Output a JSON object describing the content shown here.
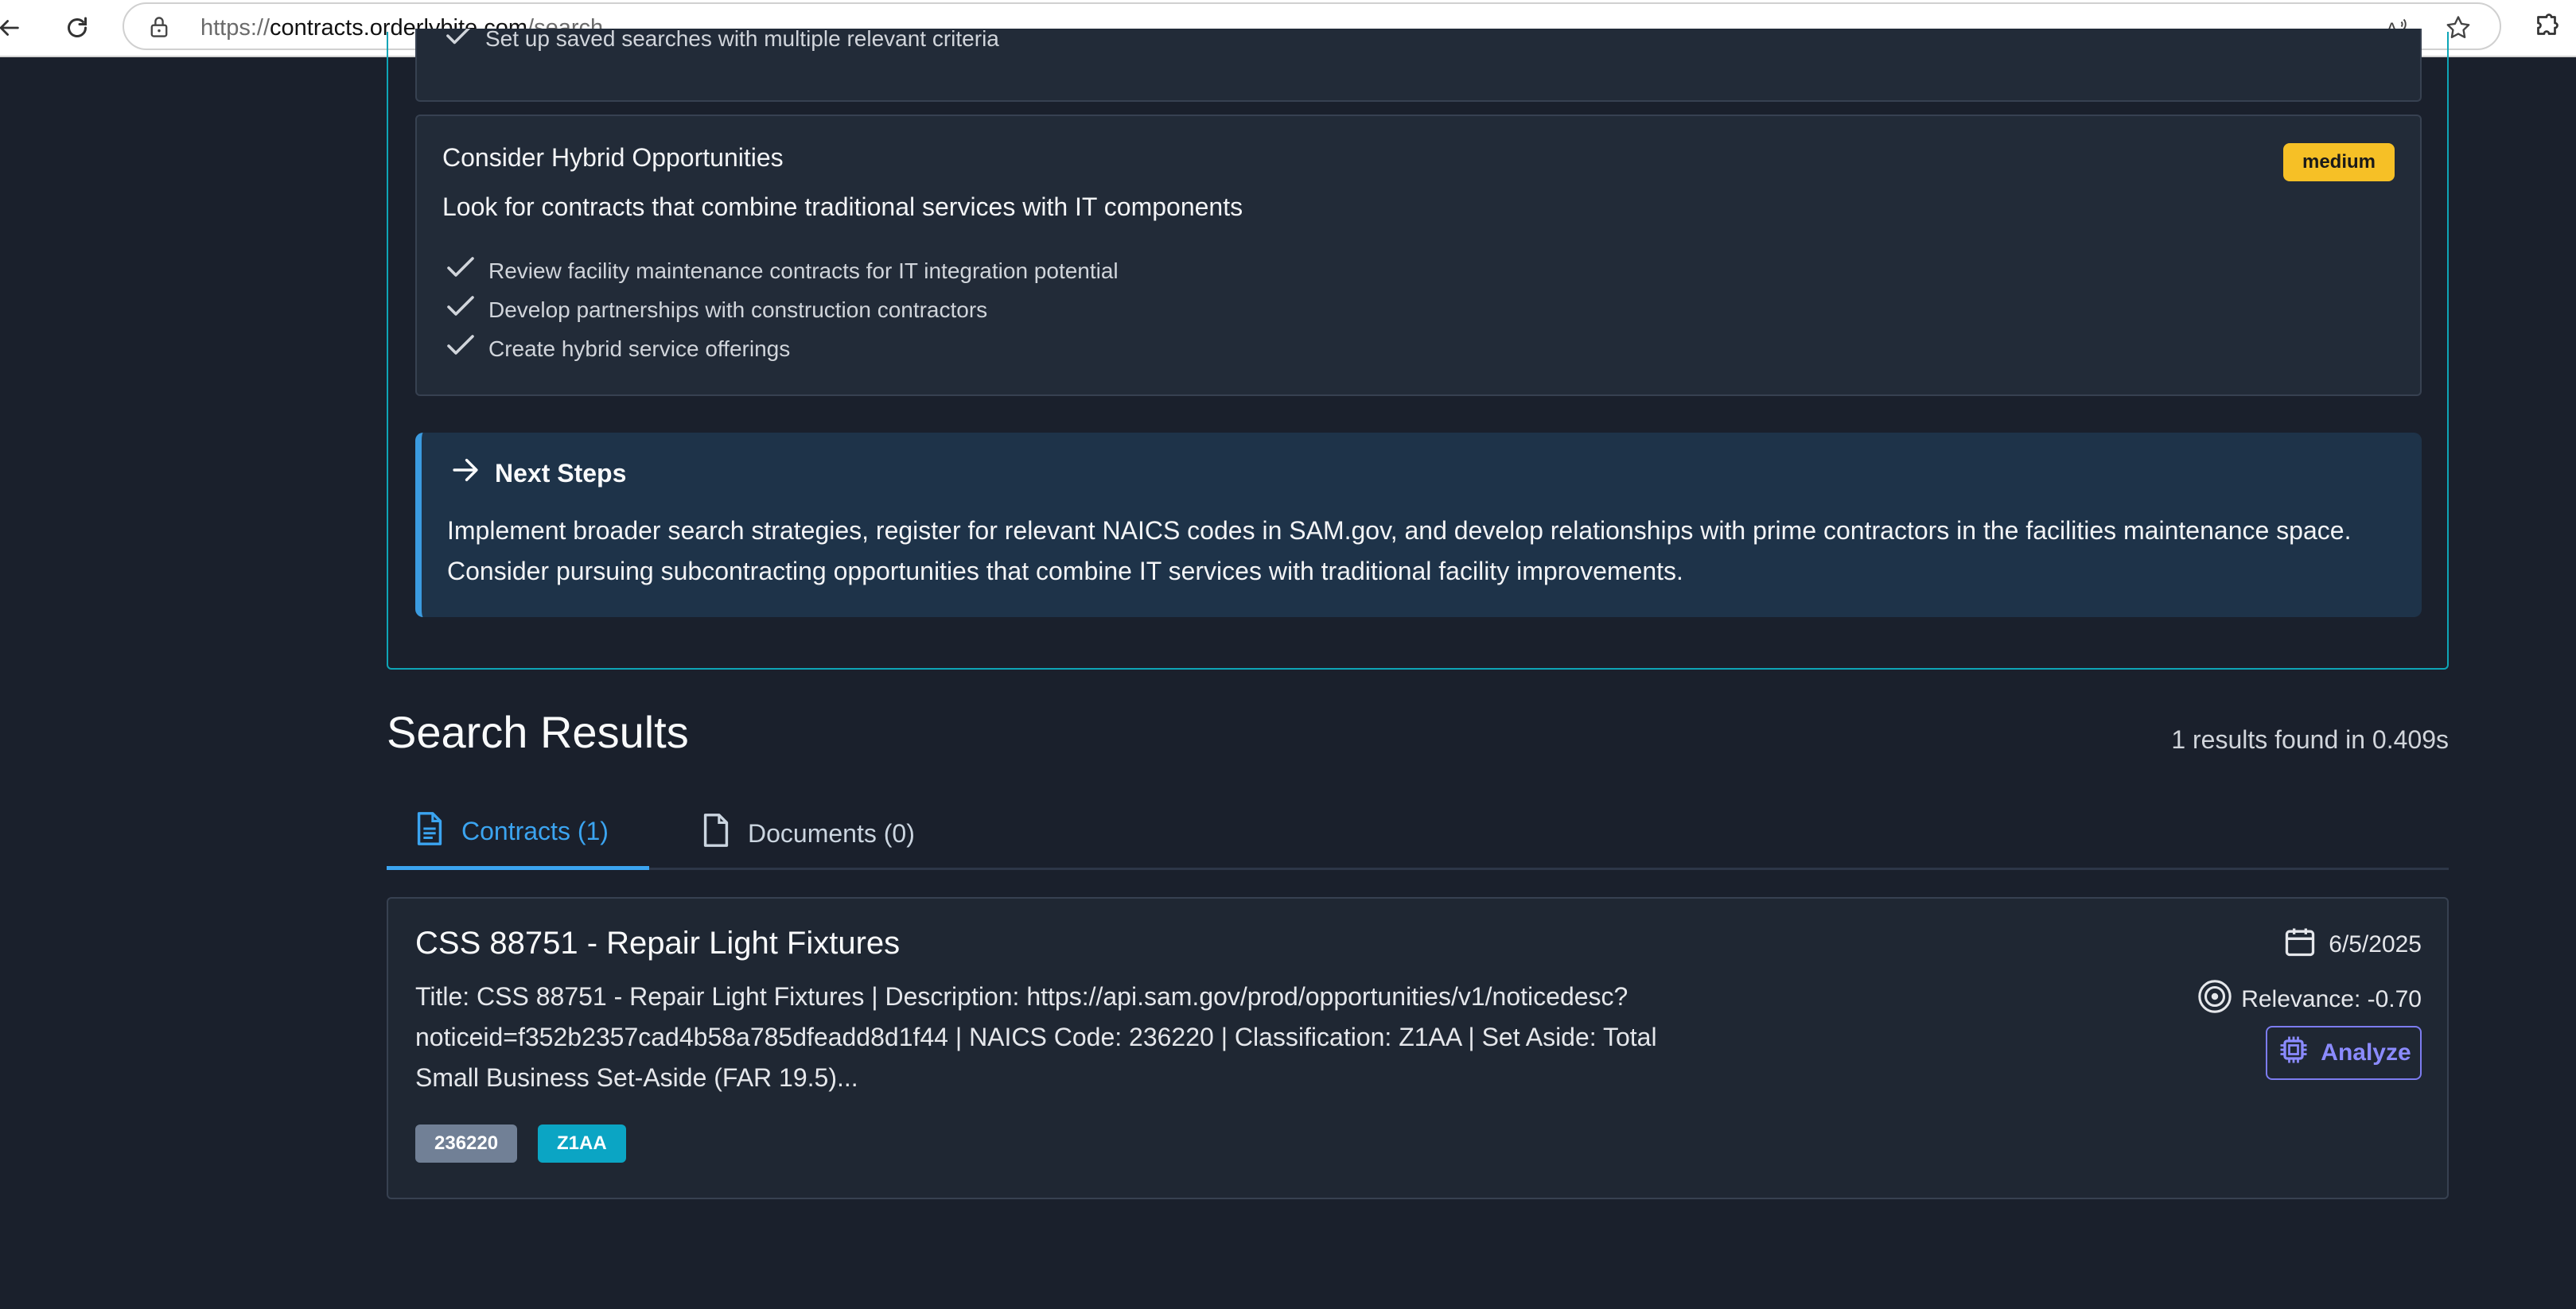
{
  "browser": {
    "url_prefix": "https://",
    "url_host": "contracts.orderlybite.com",
    "url_path": "/search"
  },
  "previous_card": {
    "clipped_item": "Set up saved searches with multiple relevant criteria"
  },
  "recommendation": {
    "title": "Consider Hybrid Opportunities",
    "priority": "medium",
    "description": "Look for contracts that combine traditional services with IT components",
    "items": [
      "Review facility maintenance contracts for IT integration potential",
      "Develop partnerships with construction contractors",
      "Create hybrid service offerings"
    ]
  },
  "next_steps": {
    "heading": "Next Steps",
    "body": "Implement broader search strategies, register for relevant NAICS codes in SAM.gov, and develop relationships with prime contractors in the facilities maintenance space. Consider pursuing subcontracting opportunities that combine IT services with traditional facility improvements."
  },
  "results": {
    "title": "Search Results",
    "count_text": "1 results found in 0.409s",
    "tabs": [
      {
        "label": "Contracts (1)",
        "active": true,
        "icon": "document-text-icon"
      },
      {
        "label": "Documents (0)",
        "active": false,
        "icon": "document-icon"
      }
    ],
    "items": [
      {
        "title": "CSS 88751 - Repair Light Fixtures",
        "description": "Title: CSS 88751 - Repair Light Fixtures | Description: https://api.sam.gov/prod/opportunities/v1/noticedesc?noticeid=f352b2357cad4b58a785dfeadd8d1f44 | NAICS Code: 236220 | Classification: Z1AA | Set Aside: Total Small Business Set-Aside (FAR 19.5)...",
        "date": "6/5/2025",
        "relevance": "Relevance: -0.70",
        "analyze_label": "Analyze",
        "tags": [
          "236220",
          "Z1AA"
        ]
      }
    ]
  },
  "colors": {
    "background": "#1a202c",
    "accent_teal": "#0ea5b7",
    "accent_blue": "#3ba4f0",
    "badge_medium": "#f6c026",
    "analyze_purple": "#7c7cf0"
  }
}
